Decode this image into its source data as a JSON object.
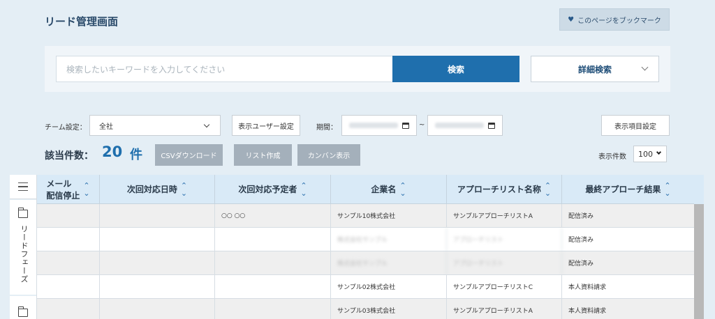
{
  "header": {
    "title": "リード管理画面",
    "bookmark_label": "このページをブックマーク",
    "bookmark_icon": "heart-icon"
  },
  "search": {
    "placeholder": "検索したいキーワードを入力してください",
    "value": "",
    "submit_label": "検索",
    "advanced_label": "詳細検索"
  },
  "filters": {
    "team_label": "チーム設定：",
    "team_value": "全社",
    "display_users_label": "表示ユーザー設定",
    "period_label": "期間：",
    "period_separator": "~",
    "display_columns_label": "表示項目設定"
  },
  "results": {
    "count_label": "該当件数：",
    "count_value": "20",
    "count_unit": "件",
    "csv_label": "CSVダウンロード",
    "list_label": "リスト作成",
    "kanban_label": "カンバン表示",
    "per_page_label": "表示件数",
    "per_page_value": "100"
  },
  "sidebar": {
    "phase_label": "リードフェーズ"
  },
  "table": {
    "columns": [
      {
        "label": "メール\n配信停止"
      },
      {
        "label": "次回対応日時"
      },
      {
        "label": "次回対応予定者"
      },
      {
        "label": "企業名"
      },
      {
        "label": "アプローチリスト名称"
      },
      {
        "label": "最終アプローチ結果"
      }
    ],
    "rows": [
      [
        "",
        "",
        "○○ ○○",
        "サンプル10株式会社",
        "サンプルアプローチリストA",
        "配信済み"
      ],
      [
        "",
        "",
        "",
        "株式会社サンプル",
        "アプローチリスト",
        "配信済み"
      ],
      [
        "",
        "",
        "",
        "株式会社サンプル",
        "アプローチリスト",
        "配信済み"
      ],
      [
        "",
        "",
        "",
        "サンプル02株式会社",
        "サンプルアプローチリストC",
        "本人資料請求"
      ],
      [
        "",
        "",
        "",
        "サンプル03株式会社",
        "サンプルアプローチリストA",
        "本人資料請求"
      ]
    ]
  },
  "colors": {
    "accent": "#1f6fad",
    "header_bg": "#d9eaf7",
    "page_bg": "#e4eef5"
  }
}
